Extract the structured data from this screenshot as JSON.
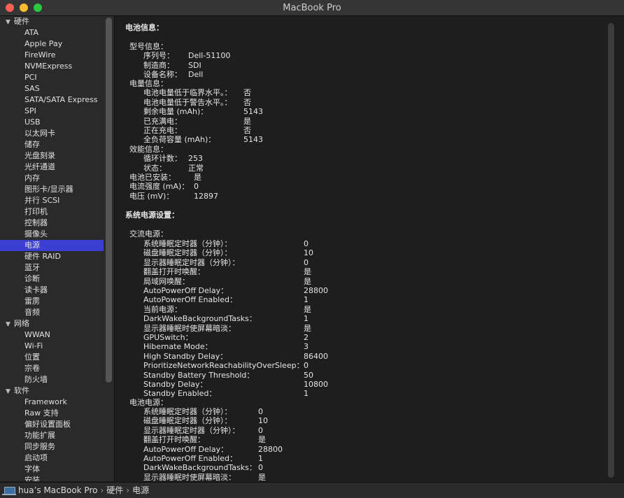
{
  "window": {
    "title": "MacBook Pro"
  },
  "sidebar": {
    "rows": [
      {
        "kind": "group",
        "label": "硬件"
      },
      {
        "kind": "item",
        "label": "ATA"
      },
      {
        "kind": "item",
        "label": "Apple Pay"
      },
      {
        "kind": "item",
        "label": "FireWire"
      },
      {
        "kind": "item",
        "label": "NVMExpress"
      },
      {
        "kind": "item",
        "label": "PCI"
      },
      {
        "kind": "item",
        "label": "SAS"
      },
      {
        "kind": "item",
        "label": "SATA/SATA Express"
      },
      {
        "kind": "item",
        "label": "SPI"
      },
      {
        "kind": "item",
        "label": "USB"
      },
      {
        "kind": "item",
        "label": "以太网卡"
      },
      {
        "kind": "item",
        "label": "储存"
      },
      {
        "kind": "item",
        "label": "光盘刻录"
      },
      {
        "kind": "item",
        "label": "光纤通道"
      },
      {
        "kind": "item",
        "label": "内存"
      },
      {
        "kind": "item",
        "label": "图形卡/显示器"
      },
      {
        "kind": "item",
        "label": "并行 SCSI"
      },
      {
        "kind": "item",
        "label": "打印机"
      },
      {
        "kind": "item",
        "label": "控制器"
      },
      {
        "kind": "item",
        "label": "摄像头"
      },
      {
        "kind": "item",
        "label": "电源",
        "selected": true
      },
      {
        "kind": "item",
        "label": "硬件 RAID"
      },
      {
        "kind": "item",
        "label": "蓝牙"
      },
      {
        "kind": "item",
        "label": "诊断"
      },
      {
        "kind": "item",
        "label": "读卡器"
      },
      {
        "kind": "item",
        "label": "雷雳"
      },
      {
        "kind": "item",
        "label": "音频"
      },
      {
        "kind": "group",
        "label": "网络"
      },
      {
        "kind": "item",
        "label": "WWAN"
      },
      {
        "kind": "item",
        "label": "Wi-Fi"
      },
      {
        "kind": "item",
        "label": "位置"
      },
      {
        "kind": "item",
        "label": "宗卷"
      },
      {
        "kind": "item",
        "label": "防火墙"
      },
      {
        "kind": "group",
        "label": "软件"
      },
      {
        "kind": "item",
        "label": "Framework"
      },
      {
        "kind": "item",
        "label": "Raw 支持"
      },
      {
        "kind": "item",
        "label": "偏好设置面板"
      },
      {
        "kind": "item",
        "label": "功能扩展"
      },
      {
        "kind": "item",
        "label": "同步服务"
      },
      {
        "kind": "item",
        "label": "启动项"
      },
      {
        "kind": "item",
        "label": "字体"
      },
      {
        "kind": "item",
        "label": "安装"
      }
    ]
  },
  "battery": {
    "header": "电池信息：",
    "model_header": "型号信息：",
    "serial_label": "序列号：",
    "serial": "Dell-51100",
    "maker_label": "制造商：",
    "maker": "SDI",
    "device_label": "设备名称：",
    "device": "Dell",
    "charge_header": "电量信息：",
    "below_critical_label": "电池电量低于临界水平。：",
    "below_critical": "否",
    "below_warning_label": "电池电量低于警告水平。：",
    "below_warning": "否",
    "remaining_label": "剩余电量 (mAh)：",
    "remaining": "5143",
    "fully_charged_label": "已充满电：",
    "fully_charged": "是",
    "charging_label": "正在充电：",
    "charging": "否",
    "full_capacity_label": "全负荷容量 (mAh)：",
    "full_capacity": "5143",
    "health_header": "效能信息：",
    "cycle_label": "循环计数：",
    "cycle": "253",
    "condition_label": "状态：",
    "condition": "正常",
    "installed_label": "电池已安装：",
    "installed": "是",
    "amperage_label": "电流强度 (mA)：",
    "amperage": "0",
    "voltage_label": "电压 (mV)：",
    "voltage": "12897"
  },
  "power": {
    "header": "系统电源设置：",
    "ac_header": "交流电源：",
    "ac": [
      {
        "label": "系统睡眠定时器（分钟）：",
        "value": "0"
      },
      {
        "label": "磁盘睡眠定时器（分钟）：",
        "value": "10"
      },
      {
        "label": "显示器睡眠定时器（分钟）：",
        "value": "0"
      },
      {
        "label": "翻盖打开时唤醒：",
        "value": "是"
      },
      {
        "label": "局域网唤醒：",
        "value": "是"
      },
      {
        "label": "AutoPowerOff Delay：",
        "value": "28800"
      },
      {
        "label": "AutoPowerOff Enabled：",
        "value": "1"
      },
      {
        "label": "当前电源：",
        "value": "是"
      },
      {
        "label": "DarkWakeBackgroundTasks：",
        "value": "1"
      },
      {
        "label": "显示器睡眠时使屏幕暗淡：",
        "value": "是"
      },
      {
        "label": "GPUSwitch：",
        "value": "2"
      },
      {
        "label": "Hibernate Mode：",
        "value": "3"
      },
      {
        "label": "High Standby Delay：",
        "value": "86400"
      },
      {
        "label": "PrioritizeNetworkReachabilityOverSleep：",
        "value": "0"
      },
      {
        "label": "Standby Battery Threshold：",
        "value": "50"
      },
      {
        "label": "Standby Delay：",
        "value": "10800"
      },
      {
        "label": "Standby Enabled：",
        "value": "1"
      }
    ],
    "battery_header": "电池电源：",
    "battery": [
      {
        "label": "系统睡眠定时器（分钟）：",
        "value": "0"
      },
      {
        "label": "磁盘睡眠定时器（分钟）：",
        "value": "10"
      },
      {
        "label": "显示器睡眠定时器（分钟）：",
        "value": "0"
      },
      {
        "label": "翻盖打开时唤醒：",
        "value": "是"
      },
      {
        "label": "AutoPowerOff Delay：",
        "value": "28800"
      },
      {
        "label": "AutoPowerOff Enabled：",
        "value": "1"
      },
      {
        "label": "DarkWakeBackgroundTasks：",
        "value": "0"
      },
      {
        "label": "显示器睡眠时使屏幕暗淡：",
        "value": "是"
      }
    ]
  },
  "statusbar": {
    "crumb_machine": "hua’s MacBook Pro",
    "crumb_section": "硬件",
    "crumb_item": "电源",
    "separator": "›"
  }
}
